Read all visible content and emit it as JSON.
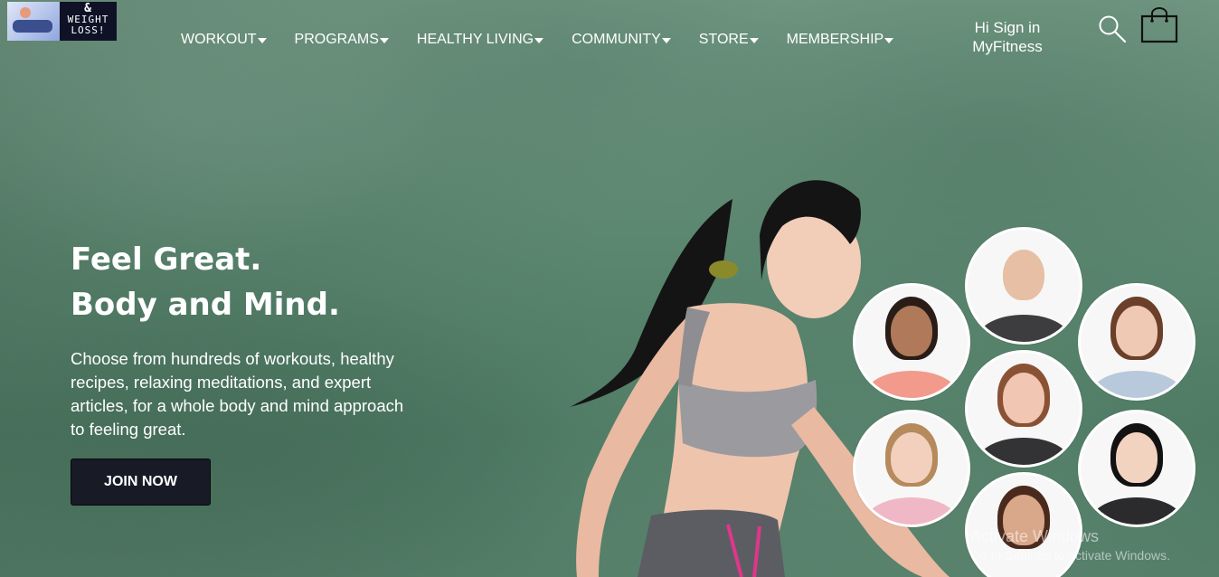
{
  "logo": {
    "amp": "&",
    "line1": "WEIGHT",
    "line2": "LOSS!"
  },
  "nav": {
    "items": [
      {
        "label": "WORKOUT"
      },
      {
        "label": "PROGRAMS"
      },
      {
        "label": "HEALTHY LIVING"
      },
      {
        "label": "COMMUNITY"
      },
      {
        "label": "STORE"
      },
      {
        "label": "MEMBERSHIP"
      }
    ]
  },
  "header": {
    "signin_line1": "Hi Sign in",
    "signin_line2": "MyFitness",
    "search_icon": "search-icon",
    "bag_icon": "shopping-bag-icon"
  },
  "hero": {
    "title_line1": "Feel Great.",
    "title_line2": "Body and Mind.",
    "description": "Choose from hundreds of workouts, healthy recipes, relaxing meditations, and expert articles, for a whole body and mind approach to feeling great.",
    "cta_label": "JOIN NOW"
  },
  "watermark": {
    "title": "Activate Windows",
    "subtitle": "Go to Settings to activate Windows."
  },
  "colors": {
    "button_bg": "#181a26",
    "text": "#ffffff",
    "hero_green": "#5c8770"
  }
}
